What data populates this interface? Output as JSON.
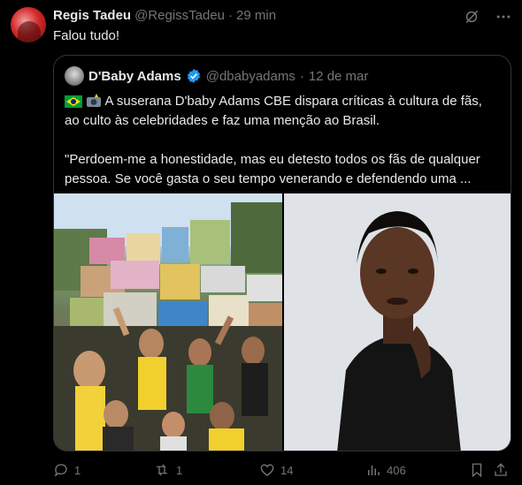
{
  "author": {
    "name": "Regis Tadeu",
    "handle": "@RegissTadeu",
    "separator": "·",
    "time": "29 min",
    "avatar_icon": "red-profile-avatar"
  },
  "text": "Falou tudo!",
  "top_icons": [
    "grok-icon",
    "more-icon"
  ],
  "quoted": {
    "name": "D'Baby Adams",
    "handle": "@dbabyadams",
    "separator": "·",
    "date": "12 de mar",
    "verified_color": "#1d9bf0",
    "flag_emojis": [
      "brazil-flag-icon",
      "camera-flash-icon"
    ],
    "line1": "A suserana D'baby Adams CBE dispara críticas à cultura de fãs,",
    "line2": "ao culto às celebridades e faz uma menção ao Brasil.",
    "line3": "\"Perdoem-me a honestidade, mas eu detesto todos os fãs de qualquer",
    "line4": "pessoa. Se você gasta o seu tempo venerando e defendendo uma ...",
    "images": [
      "brazil-football-fans-favela-photo",
      "woman-portrait-photo"
    ]
  },
  "actions": {
    "replies": "1",
    "reposts": "1",
    "likes": "14",
    "views": "406"
  },
  "colors": {
    "background": "#000000",
    "text": "#e7e9ea",
    "muted": "#71767b",
    "border": "#2f3336"
  }
}
